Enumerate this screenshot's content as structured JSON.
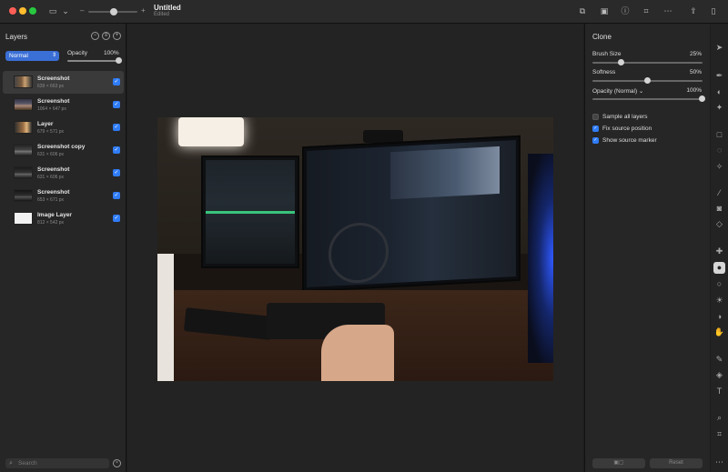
{
  "window": {
    "title": "Untitled",
    "subtitle": "Edited"
  },
  "toolbar": {
    "zoom_value": 0.5,
    "icons": [
      "sidebar-toggle-icon",
      "chevron-down-icon",
      "zoom-minus-icon",
      "zoom-plus-icon",
      "arrange-icon",
      "image-icon",
      "info-icon",
      "crop-icon",
      "more-icon",
      "share-icon",
      "inspector-toggle-icon"
    ]
  },
  "layers_panel": {
    "title": "Layers",
    "blend_mode": "Normal",
    "opacity_label": "Opacity",
    "opacity_value": "100%",
    "items": [
      {
        "name": "Screenshot",
        "size": "639 × 663 px",
        "selected": true
      },
      {
        "name": "Screenshot",
        "size": "1064 × 647 px",
        "selected": false
      },
      {
        "name": "Layer",
        "size": "679 × 571 px",
        "selected": false
      },
      {
        "name": "Screenshot copy",
        "size": "631 × 606 px",
        "selected": false
      },
      {
        "name": "Screenshot",
        "size": "631 × 606 px",
        "selected": false
      },
      {
        "name": "Screenshot",
        "size": "653 × 671 px",
        "selected": false
      },
      {
        "name": "Image Layer",
        "size": "812 × 542 px",
        "selected": false
      }
    ],
    "search_placeholder": "Search"
  },
  "clone_panel": {
    "title": "Clone",
    "brush_size_label": "Brush Size",
    "brush_size_value": "25%",
    "softness_label": "Softness",
    "softness_value": "50%",
    "opacity_label": "Opacity (Normal) ⌄",
    "opacity_value": "100%",
    "sample_all_layers": "Sample all layers",
    "fix_source_position": "Fix source position",
    "show_source_marker": "Show source marker",
    "reset_label": "Reset"
  },
  "colors": {
    "accent": "#2f7cf6",
    "blend": "#3a6fd6"
  }
}
